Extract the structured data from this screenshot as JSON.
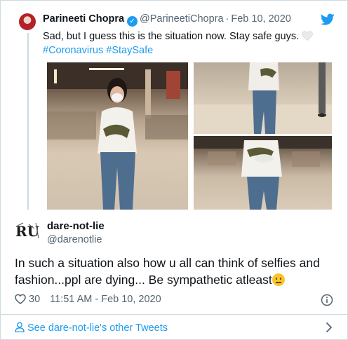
{
  "quoted_tweet": {
    "author_name": "Parineeti Chopra",
    "handle": "@ParineetiChopra",
    "separator": "·",
    "date": "Feb 10, 2020",
    "text": "Sad, but I guess this is the situation now. Stay safe guys.",
    "hashtags": [
      "#Coronavirus",
      "#StaySafe"
    ],
    "photos": [
      "photo-1",
      "photo-2",
      "photo-3"
    ]
  },
  "tweet": {
    "author_name": "dare-not-lie",
    "handle": "@darenotlie",
    "avatar_text": "RU",
    "text": "In such a situation also how u all can think of selfies and fashion...ppl are dying... Be sympathetic atleast",
    "like_count": "30",
    "timestamp": "11:51 AM - Feb 10, 2020"
  },
  "footer": {
    "see_more_label": "See dare-not-lie's other Tweets"
  },
  "icons": {
    "logo": "twitter-bird-icon",
    "verified": "verified-badge-icon",
    "like": "heart-outline-icon",
    "info": "info-circle-icon",
    "person": "person-icon",
    "chevron": "chevron-right-icon",
    "emoji_1": "white-heart-emoji",
    "emoji_2": "neutral-face-emoji"
  },
  "colors": {
    "accent": "#1d9bf0",
    "text": "#0f1419",
    "muted": "#536471",
    "border": "#cfd9de"
  }
}
